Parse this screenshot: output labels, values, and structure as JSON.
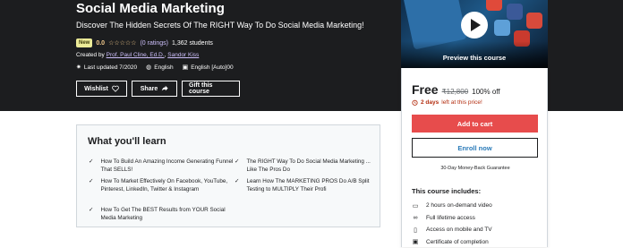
{
  "course": {
    "title": "Social Media Marketing",
    "subtitle": "Discover The Hidden Secrets Of The RIGHT Way To Do Social Media Marketing!",
    "badge": "New",
    "rating": "0.0",
    "stars": "☆☆☆☆☆",
    "ratings_count": "(0 ratings)",
    "students": "1,362 students",
    "created_by_label": "Created by",
    "instructor_1": "Prof. Paul Cline, Ed.D.",
    "instructor_2": "Sandor Kiss",
    "last_updated": "Last updated 7/2020",
    "language": "English",
    "captions": "English [Auto]00"
  },
  "actions": {
    "wishlist": "Wishlist",
    "share": "Share",
    "gift": "Gift this course"
  },
  "preview": {
    "label": "Preview this course"
  },
  "purchase": {
    "price": "Free",
    "original_price": "₹12,800",
    "discount": "100% off",
    "timer_bold": "2 days",
    "timer_rest": "left at this price!",
    "add_to_cart": "Add to cart",
    "enroll_now": "Enroll now",
    "guarantee": "30-Day Money-Back Guarantee",
    "includes_title": "This course includes:",
    "includes": [
      {
        "icon": "video-icon",
        "glyph": "▭",
        "text": "2 hours on-demand video"
      },
      {
        "icon": "infinity-icon",
        "glyph": "∞",
        "text": "Full lifetime access"
      },
      {
        "icon": "mobile-icon",
        "glyph": "▯",
        "text": "Access on mobile and TV"
      },
      {
        "icon": "certificate-icon",
        "glyph": "▣",
        "text": "Certificate of completion"
      }
    ]
  },
  "learn": {
    "title": "What you'll learn",
    "items": [
      "How To Build An Amazing Income Generating Funnel That SELLS!",
      "The RIGHT Way To Do Social Media Marketing ... Like The Pros Do",
      "How To Market Effectively On Facebook, YouTube, Pinterest, LinkedIn, Twitter & Instagram",
      "Learn How The MARKETING PROS Do A/B Split Testing to MULTIPLY Their Profi",
      "How To Get The BEST Results from YOUR Social Media Marketing"
    ]
  },
  "colors": {
    "hero_bg": "#1c1d1f",
    "cart_button": "#e74c4c",
    "enroll_text": "#2b7bb9",
    "badge_bg": "#eceb98",
    "star": "#f3ca8c",
    "timer": "#b32d0f"
  }
}
